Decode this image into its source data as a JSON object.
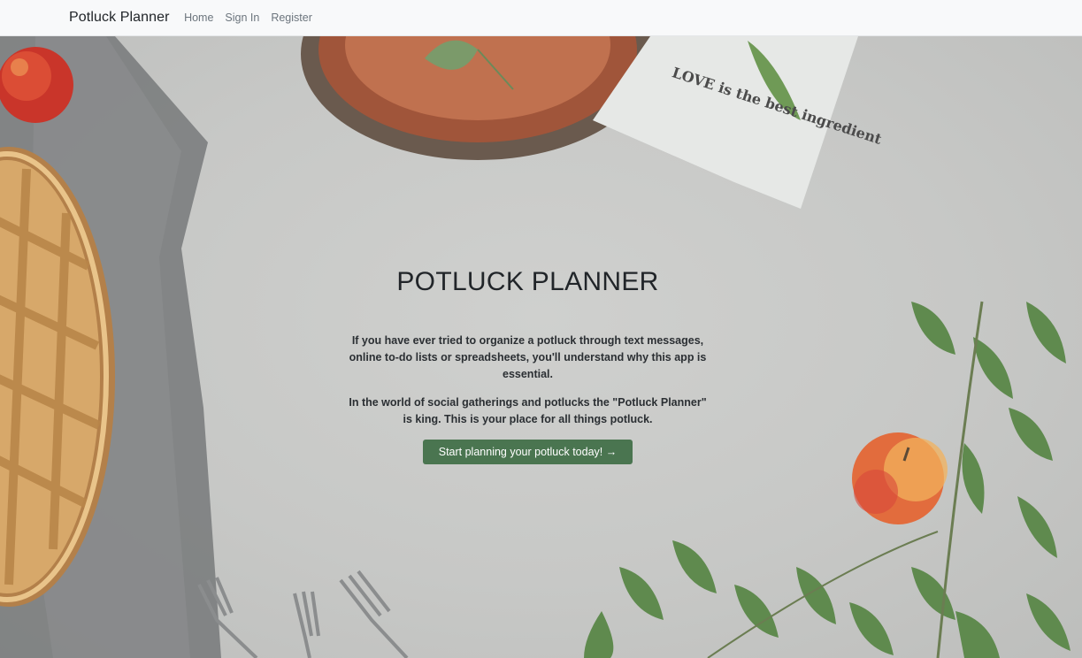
{
  "navbar": {
    "brand": "Potluck Planner",
    "links": [
      "Home",
      "Sign In",
      "Register"
    ]
  },
  "hero": {
    "title": "POTLUCK PLANNER",
    "paragraph1": "If you have ever tried to organize a potluck through text messages, online to-do lists or spreadsheets, you'll understand why this app is essential.",
    "paragraph2": "In the world of social gatherings and potlucks the \"Potluck Planner\" is king. This is your place for all things potluck.",
    "cta_label": "Start planning your potluck today! →",
    "napkin_text": "LOVE is the best ingredient"
  },
  "colors": {
    "button": "#4a7550",
    "navbar_bg": "#f8f9fa",
    "text": "#212529"
  }
}
